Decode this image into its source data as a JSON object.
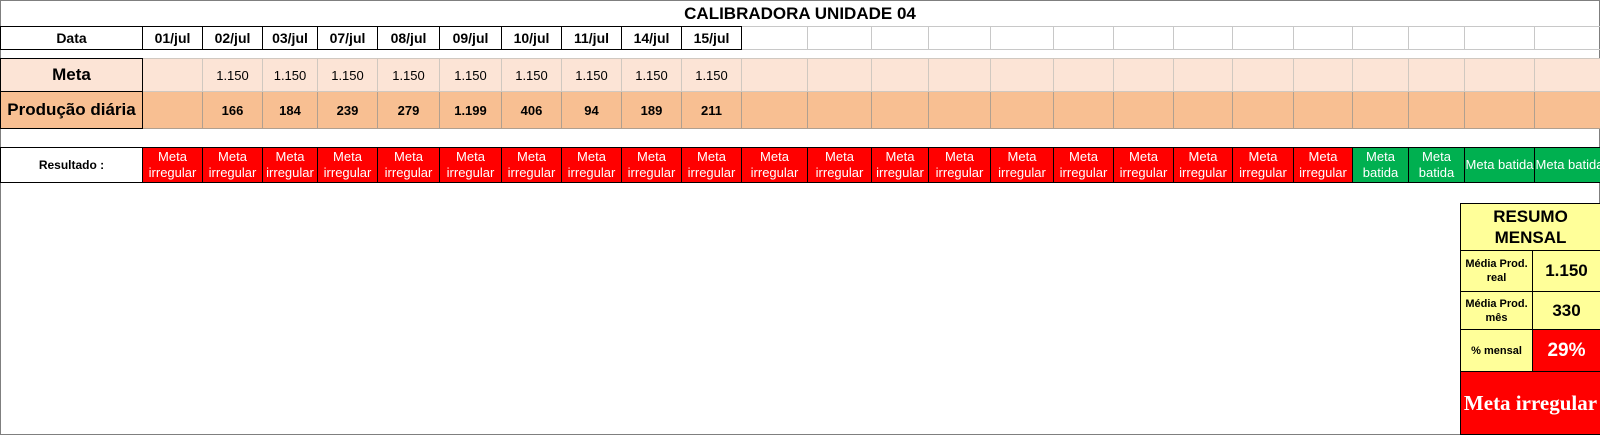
{
  "title": "CALIBRADORA UNIDADE 04",
  "row_labels": {
    "data": "Data",
    "meta": "Meta",
    "producao": "Produção diária",
    "resultado": "Resultado :"
  },
  "dates": [
    "01/jul",
    "02/jul",
    "03/jul",
    "07/jul",
    "08/jul",
    "09/jul",
    "10/jul",
    "11/jul",
    "14/jul",
    "15/jul",
    "",
    "",
    "",
    "",
    "",
    "",
    "",
    "",
    "",
    "",
    "",
    "",
    "",
    ""
  ],
  "meta_values": [
    "",
    "1.150",
    "1.150",
    "1.150",
    "1.150",
    "1.150",
    "1.150",
    "1.150",
    "1.150",
    "1.150",
    "",
    "",
    "",
    "",
    "",
    "",
    "",
    "",
    "",
    "",
    "",
    "",
    "",
    ""
  ],
  "producao_values": [
    "",
    "166",
    "184",
    "239",
    "279",
    "1.199",
    "406",
    "94",
    "189",
    "211",
    "",
    "",
    "",
    "",
    "",
    "",
    "",
    "",
    "",
    "",
    "",
    "",
    "",
    ""
  ],
  "results": [
    {
      "text": "Meta irregular",
      "status": "red"
    },
    {
      "text": "Meta irregular",
      "status": "red"
    },
    {
      "text": "Meta irregular",
      "status": "red"
    },
    {
      "text": "Meta irregular",
      "status": "red"
    },
    {
      "text": "Meta irregular",
      "status": "red"
    },
    {
      "text": "Meta irregular",
      "status": "red"
    },
    {
      "text": "Meta irregular",
      "status": "red"
    },
    {
      "text": "Meta irregular",
      "status": "red"
    },
    {
      "text": "Meta irregular",
      "status": "red"
    },
    {
      "text": "Meta irregular",
      "status": "red"
    },
    {
      "text": "Meta irregular",
      "status": "red"
    },
    {
      "text": "Meta irregular",
      "status": "red"
    },
    {
      "text": "Meta irregular",
      "status": "red"
    },
    {
      "text": "Meta irregular",
      "status": "red"
    },
    {
      "text": "Meta irregular",
      "status": "red"
    },
    {
      "text": "Meta irregular",
      "status": "red"
    },
    {
      "text": "Meta irregular",
      "status": "red"
    },
    {
      "text": "Meta irregular",
      "status": "red"
    },
    {
      "text": "Meta irregular",
      "status": "red"
    },
    {
      "text": "Meta irregular",
      "status": "red"
    },
    {
      "text": "Meta batida",
      "status": "green"
    },
    {
      "text": "Meta batida",
      "status": "green"
    },
    {
      "text": "Meta batida",
      "status": "green"
    },
    {
      "text": "Meta batida",
      "status": "green"
    }
  ],
  "summary": {
    "title": "RESUMO MENSAL",
    "media_prod_real_label": "Média Prod. real",
    "media_prod_real_value": "1.150",
    "media_prod_mes_label": "Média Prod. mês",
    "media_prod_mes_value": "330",
    "pct_mensal_label": "% mensal",
    "pct_mensal_value": "29%",
    "status": "Meta irregular"
  },
  "colors": {
    "red": "#ff0000",
    "green": "#00b050",
    "meta_bg": "#fce4d6",
    "prod_bg": "#f8bf92",
    "summary_bg": "#ffff99"
  }
}
